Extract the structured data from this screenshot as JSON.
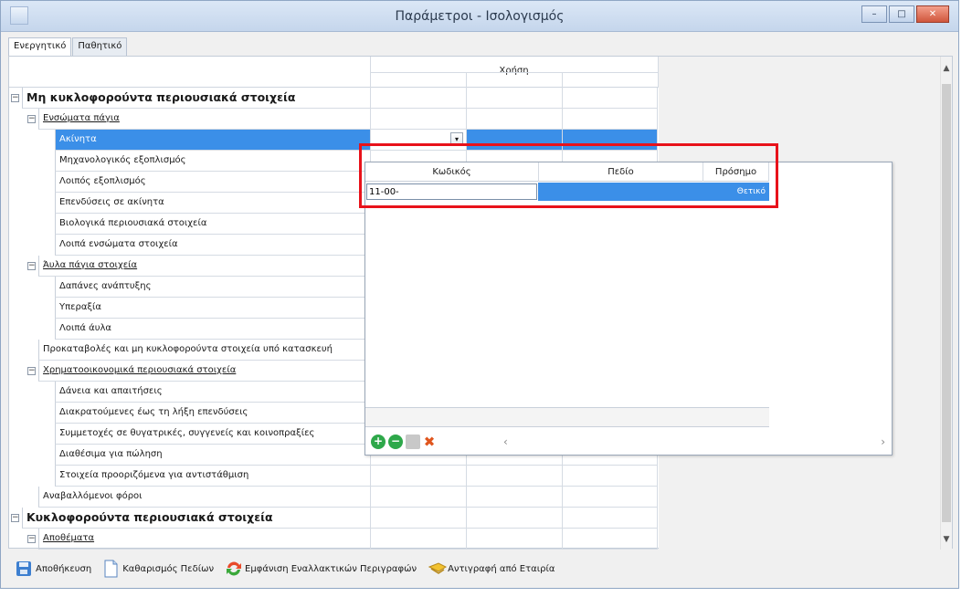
{
  "window": {
    "title": "Παράμετροι - Ισολογισμός",
    "controls": {
      "minimize": "–",
      "maximize": "□",
      "close": "✕"
    }
  },
  "tabs": [
    {
      "label": "Ενεργητικό",
      "active": true
    },
    {
      "label": "Παθητικό",
      "active": false
    }
  ],
  "grid": {
    "column_header": "Χρήση",
    "rows": [
      {
        "label": "Μη κυκλοφορούντα περιουσιακά στοιχεία",
        "level": 0,
        "bold": true,
        "toggle": "−"
      },
      {
        "label": "Ενσώματα πάγια",
        "level": 1,
        "underline": true,
        "toggle": "−"
      },
      {
        "label": "Ακίνητα",
        "level": 2,
        "selected": true
      },
      {
        "label": "Μηχανολογικός εξοπλισμός",
        "level": 2
      },
      {
        "label": "Λοιπός εξοπλισμός",
        "level": 2
      },
      {
        "label": "Επενδύσεις σε ακίνητα",
        "level": 2
      },
      {
        "label": "Βιολογικά περιουσιακά στοιχεία",
        "level": 2
      },
      {
        "label": "Λοιπά ενσώματα στοιχεία",
        "level": 2
      },
      {
        "label": "Άυλα πάγια στοιχεία",
        "level": 1,
        "underline": true,
        "toggle": "−"
      },
      {
        "label": "Δαπάνες ανάπτυξης",
        "level": 2
      },
      {
        "label": "Υπεραξία",
        "level": 2
      },
      {
        "label": "Λοιπά άυλα",
        "level": 2
      },
      {
        "label": "Προκαταβολές και μη κυκλοφορούντα στοιχεία υπό κατασκευή",
        "level": 1
      },
      {
        "label": "Χρηματοοικονομικά περιουσιακά στοιχεία",
        "level": 1,
        "underline": true,
        "toggle": "−"
      },
      {
        "label": "Δάνεια και απαιτήσεις",
        "level": 2
      },
      {
        "label": "Διακρατούμενες έως τη λήξη επενδύσεις",
        "level": 2
      },
      {
        "label": "Συμμετοχές σε θυγατρικές, συγγενείς και κοινοπραξίες",
        "level": 2
      },
      {
        "label": "Διαθέσιμα για πώληση",
        "level": 2
      },
      {
        "label": "Στοιχεία προοριζόμενα για αντιστάθμιση",
        "level": 2
      },
      {
        "label": "Αναβαλλόμενοι φόροι",
        "level": 1
      },
      {
        "label": "Κυκλοφορούντα περιουσιακά στοιχεία",
        "level": 0,
        "bold": true,
        "toggle": "−"
      },
      {
        "label": "Αποθέματα",
        "level": 1,
        "underline": true,
        "toggle": "−"
      }
    ]
  },
  "popup": {
    "columns": [
      "Κωδικός",
      "Πεδίο",
      "Πρόσημο"
    ],
    "row": {
      "code": "11-00-",
      "field": "",
      "sign": "Θετικό"
    }
  },
  "toolbar": {
    "save": "Αποθήκευση",
    "clear": "Καθαρισμός Πεδίων",
    "show_alt": "Εμφάνιση Εναλλακτικών Περιγραφών",
    "copy": "Αντιγραφή από Εταιρία"
  },
  "colors": {
    "selection": "#3b8fe8",
    "highlight_box": "#e8121a",
    "add": "#2ea84a",
    "remove": "#2ea84a",
    "delete": "#e0561e"
  }
}
